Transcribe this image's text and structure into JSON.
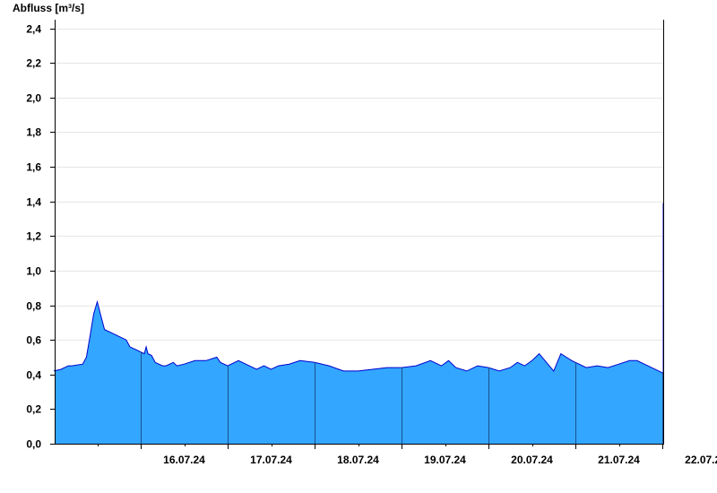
{
  "chart_data": {
    "type": "area",
    "title": "",
    "ylabel": "Abfluss [m³/s]",
    "xlabel": "",
    "ylim": [
      0,
      2.45
    ],
    "yticks": [
      0.0,
      0.2,
      0.4,
      0.6,
      0.8,
      1.0,
      1.2,
      1.4,
      1.6,
      1.8,
      2.0,
      2.2,
      2.4
    ],
    "ytick_labels": [
      "0,0",
      "0,2",
      "0,4",
      "0,6",
      "0,8",
      "1,0",
      "1,2",
      "1,4",
      "1,6",
      "1,8",
      "2,0",
      "2,2",
      "2,4"
    ],
    "x_start": "15.07.24 00:00",
    "x_end": "22.07.24 00:00",
    "date_labels": [
      "16.07.24",
      "17.07.24",
      "18.07.24",
      "19.07.24",
      "20.07.24",
      "21.07.24",
      "22.07.24"
    ],
    "grid": true,
    "fill_color": "#33a6ff",
    "line_color": "#0000cc",
    "series": [
      {
        "x": [
          "15.07.24 00:00",
          "15.07.24 02:00",
          "15.07.24 04:00",
          "15.07.24 05:00",
          "15.07.24 08:00",
          "15.07.24 09:00",
          "15.07.24 10:00",
          "15.07.24 11:00",
          "15.07.24 12:00",
          "15.07.24 13:00",
          "15.07.24 14:00",
          "15.07.24 16:00",
          "15.07.24 20:00",
          "15.07.24 21:00",
          "15.07.24 23:00",
          "16.07.24 01:00",
          "16.07.24 01:30",
          "16.07.24 02:00",
          "16.07.24 03:00",
          "16.07.24 04:00",
          "16.07.24 06:00",
          "16.07.24 07:00",
          "16.07.24 09:00",
          "16.07.24 10:00",
          "16.07.24 12:00",
          "16.07.24 15:00",
          "16.07.24 18:00",
          "16.07.24 21:00",
          "16.07.24 22:00",
          "17.07.24 00:00",
          "17.07.24 03:00",
          "17.07.24 05:00",
          "17.07.24 08:00",
          "17.07.24 10:00",
          "17.07.24 12:00",
          "17.07.24 14:00",
          "17.07.24 17:00",
          "17.07.24 20:00",
          "18.07.24 00:00",
          "18.07.24 04:00",
          "18.07.24 08:00",
          "18.07.24 12:00",
          "18.07.24 16:00",
          "18.07.24 20:00",
          "19.07.24 00:00",
          "19.07.24 04:00",
          "19.07.24 08:00",
          "19.07.24 11:00",
          "19.07.24 13:00",
          "19.07.24 15:00",
          "19.07.24 18:00",
          "19.07.24 21:00",
          "20.07.24 00:00",
          "20.07.24 03:00",
          "20.07.24 06:00",
          "20.07.24 08:00",
          "20.07.24 10:00",
          "20.07.24 12:00",
          "20.07.24 14:00",
          "20.07.24 16:00",
          "20.07.24 18:00",
          "20.07.24 20:00",
          "20.07.24 23:00",
          "21.07.24 03:00",
          "21.07.24 06:00",
          "21.07.24 09:00",
          "21.07.24 12:00",
          "21.07.24 15:00",
          "21.07.24 17:00",
          "21.07.24 20:00",
          "22.07.24 00:00",
          "22.07.24 03:00",
          "22.07.24 06:00",
          "22.07.24 09:00",
          "22.07.24 12:00",
          "22.07.24 15:00",
          "22.07.24 17:00",
          "22.07.24 18:00",
          "22.07.24 19:00",
          "22.07.24 20:00",
          "22.07.24 21:00",
          "22.07.24 22:00",
          "22.07.24 23:00",
          "23.07.24 00:00",
          "23.07.24 01:00",
          "23.07.24 02:00",
          "23.07.24 03:00",
          "23.07.24 04:00",
          "23.07.24 05:00",
          "23.07.24 06:00",
          "23.07.24 08:00"
        ],
        "y": [
          0.42,
          0.43,
          0.45,
          0.45,
          0.46,
          0.5,
          0.62,
          0.75,
          0.82,
          0.74,
          0.66,
          0.64,
          0.6,
          0.56,
          0.54,
          0.52,
          0.56,
          0.52,
          0.51,
          0.47,
          0.45,
          0.45,
          0.47,
          0.45,
          0.46,
          0.48,
          0.48,
          0.5,
          0.47,
          0.45,
          0.48,
          0.46,
          0.43,
          0.45,
          0.43,
          0.45,
          0.46,
          0.48,
          0.47,
          0.45,
          0.42,
          0.42,
          0.43,
          0.44,
          0.44,
          0.45,
          0.48,
          0.45,
          0.48,
          0.44,
          0.42,
          0.45,
          0.44,
          0.42,
          0.44,
          0.47,
          0.45,
          0.48,
          0.52,
          0.47,
          0.42,
          0.52,
          0.48,
          0.44,
          0.45,
          0.44,
          0.46,
          0.48,
          0.48,
          0.45,
          0.41,
          0.39,
          0.43,
          0.43,
          0.43,
          0.43,
          0.46,
          0.5,
          0.54,
          0.6,
          0.72,
          1.0,
          1.39,
          1.25,
          1.08,
          0.96,
          0.82,
          0.72,
          0.68,
          0.66,
          0.66
        ]
      }
    ]
  }
}
